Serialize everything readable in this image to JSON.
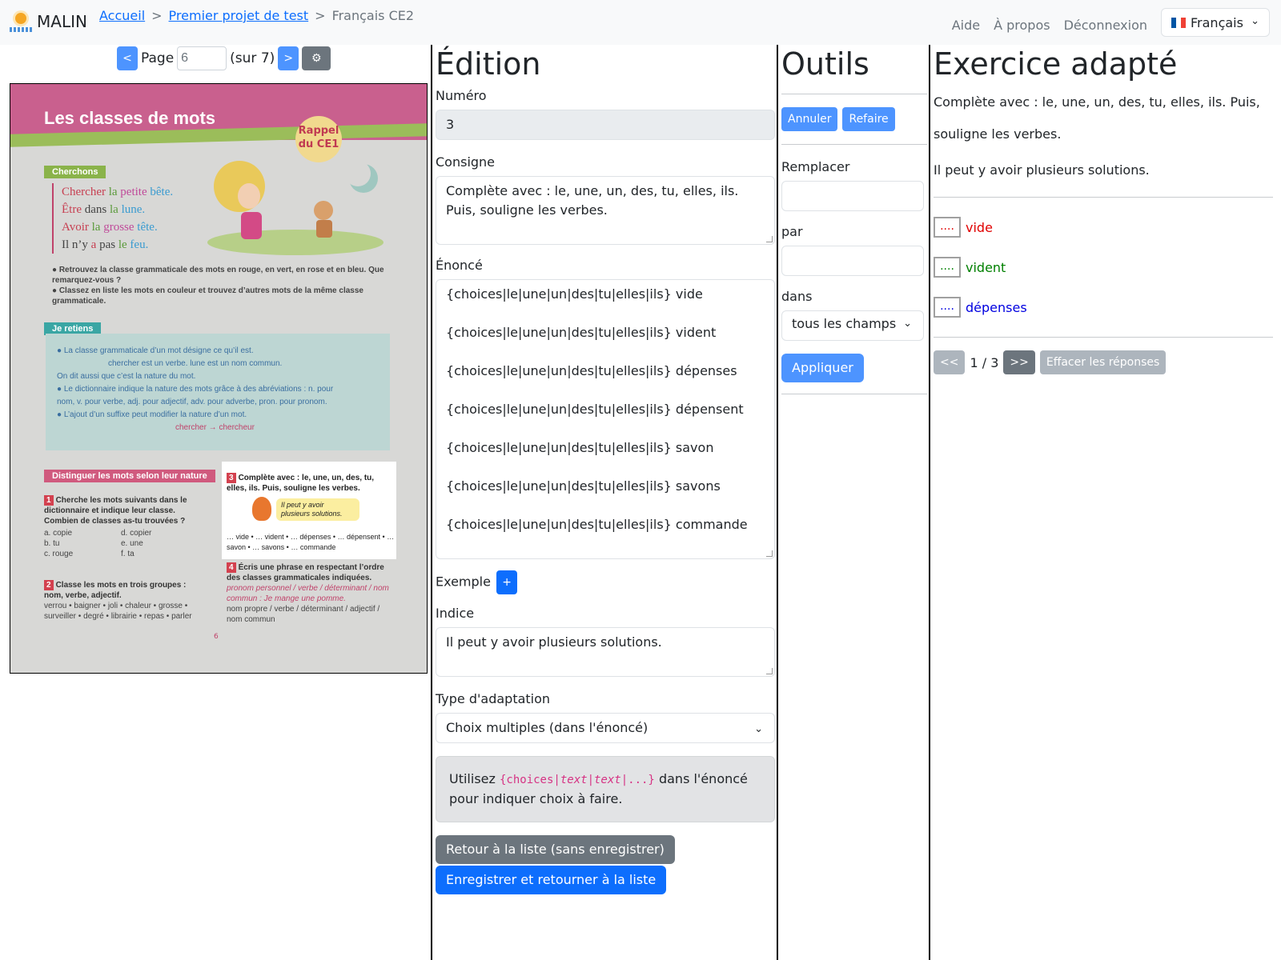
{
  "app": {
    "brand": "MALIN",
    "breadcrumb": [
      "Accueil",
      "Premier projet de test",
      "Français CE2"
    ],
    "nav_links": [
      "Aide",
      "À propos",
      "Déconnexion"
    ],
    "language": "Français"
  },
  "pager": {
    "prev": "<",
    "label": "Page",
    "page": "6",
    "total": "(sur 7)",
    "next": ">",
    "settings_icon": "gear-icon"
  },
  "book": {
    "title": "Les classes de mots",
    "badge_line1": "Rappel",
    "badge_line2": "du CE1",
    "tag_cherchons": "Cherchons",
    "lines": [
      [
        [
          "Chercher",
          "r"
        ],
        [
          " la ",
          "g"
        ],
        [
          "petite",
          "p"
        ],
        [
          " bête.",
          "b"
        ]
      ],
      [
        [
          "Être",
          "r"
        ],
        [
          " dans ",
          ""
        ],
        [
          "la",
          "g"
        ],
        [
          " lune.",
          "b"
        ]
      ],
      [
        [
          "Avoir",
          "r"
        ],
        [
          " la ",
          "g"
        ],
        [
          "grosse",
          "p"
        ],
        [
          " tête.",
          "b"
        ]
      ],
      [
        [
          "Il n’y ",
          ""
        ],
        [
          "a",
          "r"
        ],
        [
          " pas ",
          ""
        ],
        [
          "le",
          "g"
        ],
        [
          " feu.",
          "b"
        ]
      ]
    ],
    "note1": "Retrouvez la classe grammaticale des mots en rouge, en vert, en rose et en bleu. Que remarquez-vous ?",
    "note2": "Classez en liste les mots en couleur et trouvez d’autres mots de la même classe grammaticale.",
    "tag_retiens": "Je retiens",
    "retiens": [
      "La classe grammaticale d’un mot désigne ce qu’il est.",
      "chercher est un verbe.   lune est un nom commun.",
      "On dit aussi que c’est la nature du mot.",
      "Le dictionnaire indique la nature des mots grâce à des abréviations : n. pour",
      "nom, v. pour verbe, adj. pour adjectif, adv. pour adverbe, pron. pour pronom.",
      "L’ajout d’un suffixe peut modifier la nature d’un mot.",
      "chercher → chercheur"
    ],
    "tag_distinguer": "Distinguer les mots selon leur nature",
    "ex1_title": "Cherche les mots suivants dans le dictionnaire et indique leur classe. Combien de classes as-tu trouvées ?",
    "ex1_words": [
      "a. copie",
      "b. tu",
      "c. rouge",
      "d. copier",
      "e. une",
      "f. ta"
    ],
    "ex2_title": "Classe les mots en trois groupes : nom, verbe, adjectif.",
    "ex2_words": "verrou • baigner • joli • chaleur • grosse • surveiller • degré • librairie • repas • parler",
    "ex3_title": "Complète avec : le, une, un, des, tu, elles, ils. Puis, souligne les verbes.",
    "ex3_bubble": "Il peut y avoir plusieurs solutions.",
    "ex3_words": "… vide • … vident • … dépenses • … dépensent • … savon • … savons • … commande",
    "ex4_title": "Écris une phrase en respectant l’ordre des classes grammaticales indiquées.",
    "ex4_example": "pronom personnel / verbe / déterminant / nom commun : Je mange une pomme.",
    "ex4_words": "nom propre / verbe / déterminant / adjectif / nom commun",
    "page_number": "6"
  },
  "edition": {
    "title": "Édition",
    "numero_label": "Numéro",
    "numero_value": "3",
    "consigne_label": "Consigne",
    "consigne_lines": [
      "Complète avec : le, une, un, des, tu, elles, ils.",
      "Puis, souligne les verbes."
    ],
    "enonce_label": "Énoncé",
    "enonce_lines": [
      "{choices|le|une|un|des|tu|elles|ils} vide",
      "{choices|le|une|un|des|tu|elles|ils} vident",
      "{choices|le|une|un|des|tu|elles|ils} dépenses",
      "{choices|le|une|un|des|tu|elles|ils} dépensent",
      "{choices|le|une|un|des|tu|elles|ils} savon",
      "{choices|le|une|un|des|tu|elles|ils} savons",
      "{choices|le|une|un|des|tu|elles|ils} commande"
    ],
    "exemple_label": "Exemple",
    "exemple_add": "+",
    "indice_label": "Indice",
    "indice_value": "Il peut y avoir plusieurs solutions.",
    "type_label": "Type d'adaptation",
    "type_value": "Choix multiples (dans l'énoncé)",
    "hint_before": "Utilisez ",
    "hint_code_a": "{choices|",
    "hint_code_b": "text",
    "hint_code_c": "|",
    "hint_code_d": "text",
    "hint_code_e": "|...}",
    "hint_after": " dans l'énoncé pour indiquer choix à faire.",
    "back_button": "Retour à la liste (sans enregistrer)",
    "save_button": "Enregistrer et retourner à la liste"
  },
  "tools": {
    "title": "Outils",
    "undo": "Annuler",
    "redo": "Refaire",
    "replace_label": "Remplacer",
    "replace_value": "",
    "by_label": "par",
    "by_value": "",
    "in_label": "dans",
    "in_value": "tous les champs",
    "apply": "Appliquer"
  },
  "adapted": {
    "title": "Exercice adapté",
    "instruction_1": "Complète avec : le, une, un, des, tu, elles, ils. Puis,",
    "instruction_2": "souligne les verbes.",
    "hint": "Il peut y avoir plusieurs solutions.",
    "items": [
      {
        "choice": "....",
        "word": "vide",
        "color": "#e00000"
      },
      {
        "choice": "....",
        "word": "vident",
        "color": "#008000"
      },
      {
        "choice": "....",
        "word": "dépenses",
        "color": "#0000e0"
      }
    ],
    "first": "<<",
    "page": "1 / 3",
    "next": ">>",
    "clear": "Effacer les réponses"
  },
  "colors": {
    "primary": "#0d6efd",
    "primary_light": "#4d94ff",
    "secondary": "#6c757d",
    "navbar_bg": "#f8f9fa"
  }
}
